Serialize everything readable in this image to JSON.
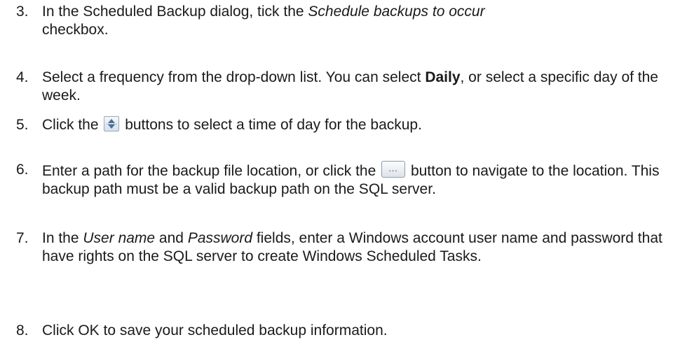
{
  "steps": [
    {
      "number": "3.",
      "parts": {
        "a": "In the Scheduled Backup dialog, tick the ",
        "b": "Schedule backups to occur",
        "c": " checkbox."
      }
    },
    {
      "number": "4.",
      "parts": {
        "a": "Select a frequency from the drop-down list. You can select ",
        "b": "Daily",
        "c": ", or select a specific day of the week."
      }
    },
    {
      "number": "5.",
      "parts": {
        "a": "Click the ",
        "icon": "spinner-up-down-icon",
        "c": " buttons to select a time of day for the backup."
      }
    },
    {
      "number": "6.",
      "parts": {
        "a": "Enter a path for the backup file location, or click the ",
        "icon": "ellipsis-browse-button-icon",
        "icon_text": "...",
        "c": " button to navigate to the location. This backup path must be a valid backup path on the SQL server."
      }
    },
    {
      "number": "7.",
      "parts": {
        "a": "In the ",
        "b": "User name",
        "c": " and ",
        "d": "Password",
        "e": " fields, enter a Windows account user name and password that have rights on the SQL server to create Windows Scheduled Tasks."
      }
    },
    {
      "number": "8.",
      "parts": {
        "a": "Click OK to save your scheduled backup information."
      }
    }
  ]
}
